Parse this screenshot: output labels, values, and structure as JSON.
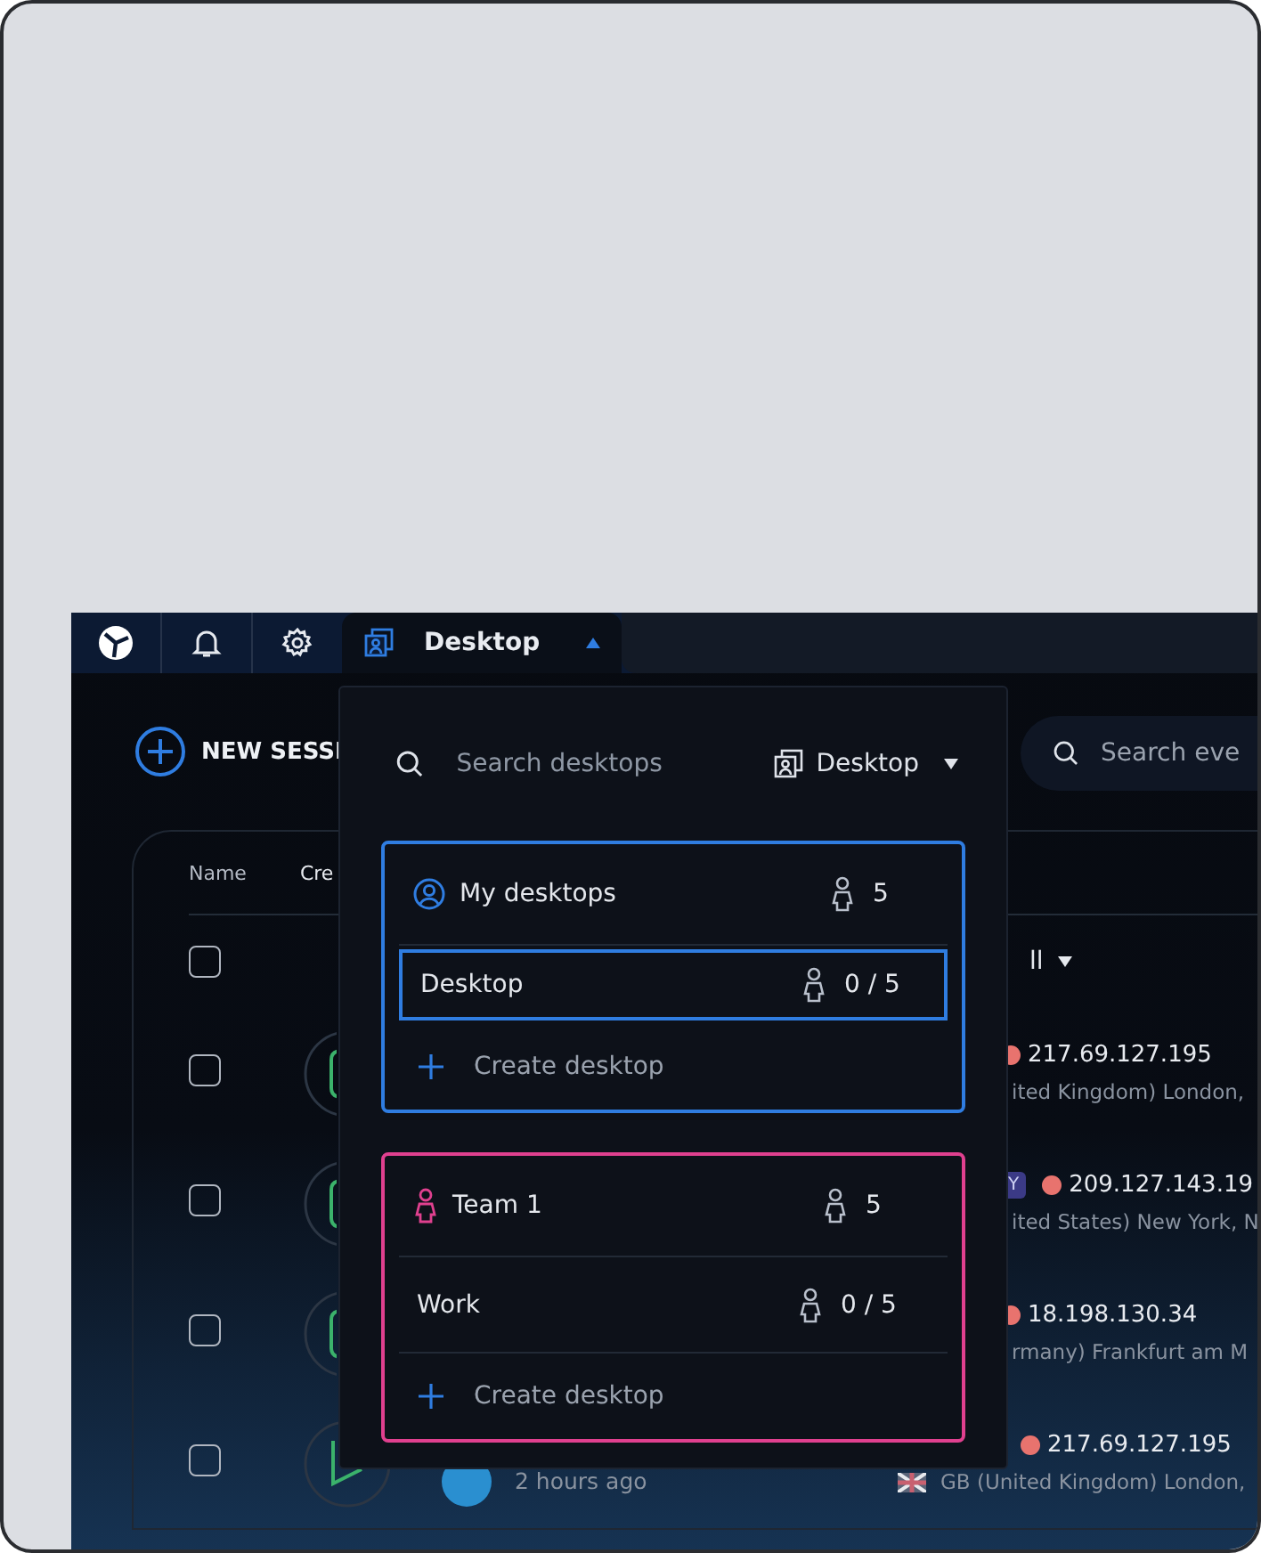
{
  "nav": {
    "tabs": [
      {
        "kind": "logo",
        "selected": false
      },
      {
        "kind": "bell",
        "selected": false
      },
      {
        "kind": "gear",
        "selected": false
      },
      {
        "kind": "desktop",
        "label": "Desktop",
        "selected": true
      }
    ]
  },
  "toolbar": {
    "new_session": "NEW SESSI",
    "search": {
      "placeholder": "Search eve"
    }
  },
  "table": {
    "columns": [
      "Name",
      "Cre"
    ],
    "filter": "ll",
    "select_all": false,
    "rows": [
      {
        "kind": "covered",
        "checked": false,
        "ip": "217.69.127.195",
        "location": "ited Kingdom) London,"
      },
      {
        "kind": "covered",
        "checked": false,
        "badge": "Y",
        "ip": "209.127.143.19",
        "location": "ited States) New York, N"
      },
      {
        "kind": "covered",
        "checked": false,
        "ip": "18.198.130.34",
        "location": "rmany) Frankfurt am M"
      },
      {
        "kind": "open",
        "checked": false,
        "time": "2 hours ago",
        "ip": "217.69.127.195",
        "location": "GB (United Kingdom) London,"
      }
    ]
  },
  "dropdown": {
    "search": {
      "placeholder": "Search desktops"
    },
    "filter": "Desktop",
    "groups": [
      {
        "kind": "personal",
        "title": "My desktops",
        "count": "5",
        "color": "#2f7de1",
        "items": [
          {
            "name": "Desktop",
            "count": "0 / 5",
            "selected": true
          }
        ],
        "create": "Create desktop"
      },
      {
        "kind": "team",
        "title": "Team 1",
        "count": "5",
        "color": "#e0408f",
        "items": [
          {
            "name": "Work",
            "count": "0 / 5",
            "selected": false
          }
        ],
        "create": "Create desktop"
      }
    ]
  }
}
